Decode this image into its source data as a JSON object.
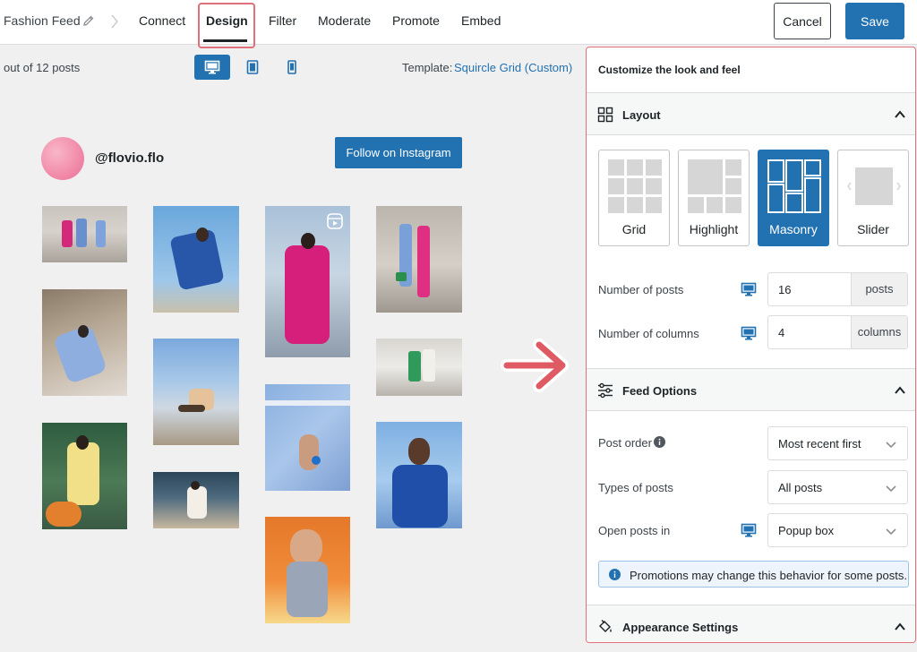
{
  "header": {
    "feed_name": "Fashion Feed",
    "tabs": [
      {
        "label": "Connect"
      },
      {
        "label": "Design"
      },
      {
        "label": "Filter"
      },
      {
        "label": "Moderate"
      },
      {
        "label": "Promote"
      },
      {
        "label": "Embed"
      }
    ],
    "active_tab": "Design",
    "cancel_label": "Cancel",
    "save_label": "Save"
  },
  "preview": {
    "post_count": "out of 12 posts",
    "devices": [
      "desktop-icon",
      "tablet-icon",
      "mobile-icon"
    ],
    "active_device": "desktop-icon",
    "template_label": "Template:",
    "template_value": "Squircle Grid (Custom)",
    "handle": "@flovio.flo",
    "follow_label": "Follow on Instagram"
  },
  "sidebar": {
    "title": "Customize the look and feel",
    "layout": {
      "title": "Layout",
      "options": [
        {
          "label": "Grid"
        },
        {
          "label": "Highlight"
        },
        {
          "label": "Masonry"
        },
        {
          "label": "Slider"
        }
      ],
      "selected": "Masonry",
      "posts_label": "Number of posts",
      "posts_value": "16",
      "posts_unit": "posts",
      "columns_label": "Number of columns",
      "columns_value": "4",
      "columns_unit": "columns"
    },
    "feed_options": {
      "title": "Feed Options",
      "post_order_label": "Post order",
      "post_order_value": "Most recent first",
      "types_label": "Types of posts",
      "types_value": "All posts",
      "open_label": "Open posts in",
      "open_value": "Popup box",
      "notice": "Promotions may change this behavior for some posts."
    },
    "appearance": {
      "title": "Appearance Settings"
    }
  },
  "colors": {
    "accent": "#2271b1",
    "highlight_border": "#e0707a",
    "arrow": "#e05a63"
  }
}
